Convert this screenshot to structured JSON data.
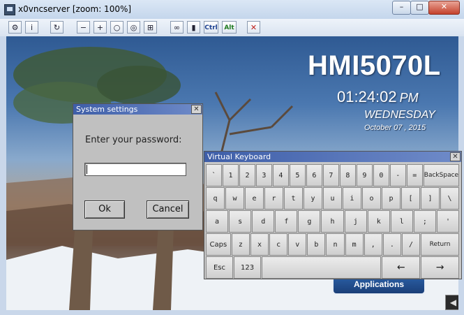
{
  "window": {
    "title": "x0vncserver [zoom: 100%]",
    "minimize": "–",
    "maximize": "□",
    "close": "✕"
  },
  "toolbar": {
    "buttons": [
      {
        "name": "options-icon",
        "glyph": "⚙"
      },
      {
        "name": "info-icon",
        "glyph": "i"
      },
      {
        "name": "refresh-icon",
        "glyph": "↻"
      },
      {
        "name": "zoom-out-icon",
        "glyph": "−"
      },
      {
        "name": "zoom-in-icon",
        "glyph": "+"
      },
      {
        "name": "zoom-100-icon",
        "glyph": "○"
      },
      {
        "name": "zoom-fit-icon",
        "glyph": "◎"
      },
      {
        "name": "fullscreen-icon",
        "glyph": "⊞"
      },
      {
        "name": "send-keys-icon",
        "glyph": "∞"
      },
      {
        "name": "transfer-icon",
        "glyph": "▮"
      }
    ],
    "ctrl_label": "Ctrl",
    "alt_label": "Alt",
    "disconnect_glyph": "✕"
  },
  "hmi": {
    "model": "HMI5070L",
    "time": "01:24:02",
    "ampm": "PM",
    "day": "WEDNESDAY",
    "date": "October  07 , 2015",
    "applications_label": "Applications",
    "back_glyph": "◀"
  },
  "dialog": {
    "title": "System settings",
    "close_glyph": "✕",
    "prompt": "Enter your password:",
    "password_value": "",
    "ok_label": "Ok",
    "cancel_label": "Cancel"
  },
  "keyboard": {
    "title": "Virtual Keyboard",
    "close_glyph": "✕",
    "row1": [
      "`",
      "1",
      "2",
      "3",
      "4",
      "5",
      "6",
      "7",
      "8",
      "9",
      "0",
      "-",
      "="
    ],
    "backspace": "BackSpace",
    "row2": [
      "q",
      "w",
      "e",
      "r",
      "t",
      "y",
      "u",
      "i",
      "o",
      "p",
      "[",
      "]",
      "\\"
    ],
    "row3": [
      "a",
      "s",
      "d",
      "f",
      "g",
      "h",
      "j",
      "k",
      "l",
      ";",
      "'"
    ],
    "caps": "Caps",
    "row4": [
      "z",
      "x",
      "c",
      "v",
      "b",
      "n",
      "m",
      ",",
      ".",
      "/"
    ],
    "return": "Return",
    "esc": "Esc",
    "num": "123",
    "left_arrow": "←",
    "right_arrow": "→"
  }
}
